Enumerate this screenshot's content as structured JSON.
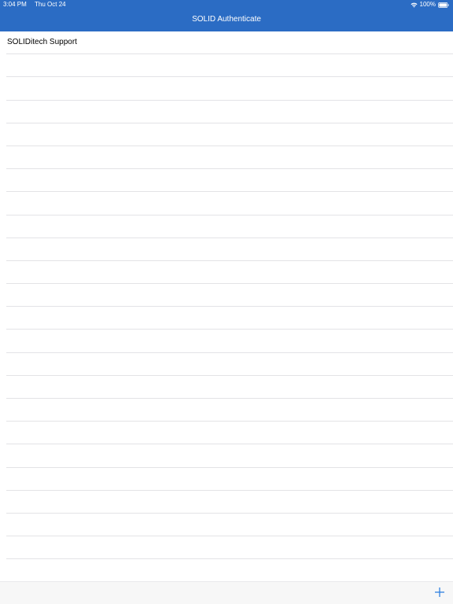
{
  "status_bar": {
    "time": "3:04 PM",
    "date": "Thu Oct 24",
    "battery": "100%",
    "icons": [
      "wifi-icon",
      "battery-icon"
    ]
  },
  "nav": {
    "title": "SOLID Authenticate"
  },
  "list": {
    "items": [
      {
        "label": "SOLIDitech Support"
      }
    ]
  },
  "toolbar": {
    "add_icon": "plus-icon"
  },
  "colors": {
    "header_bg": "#2b6cc4",
    "accent": "#2f80e0",
    "separator": "#e3e3e6",
    "toolbar_bg": "#f7f7f7"
  }
}
